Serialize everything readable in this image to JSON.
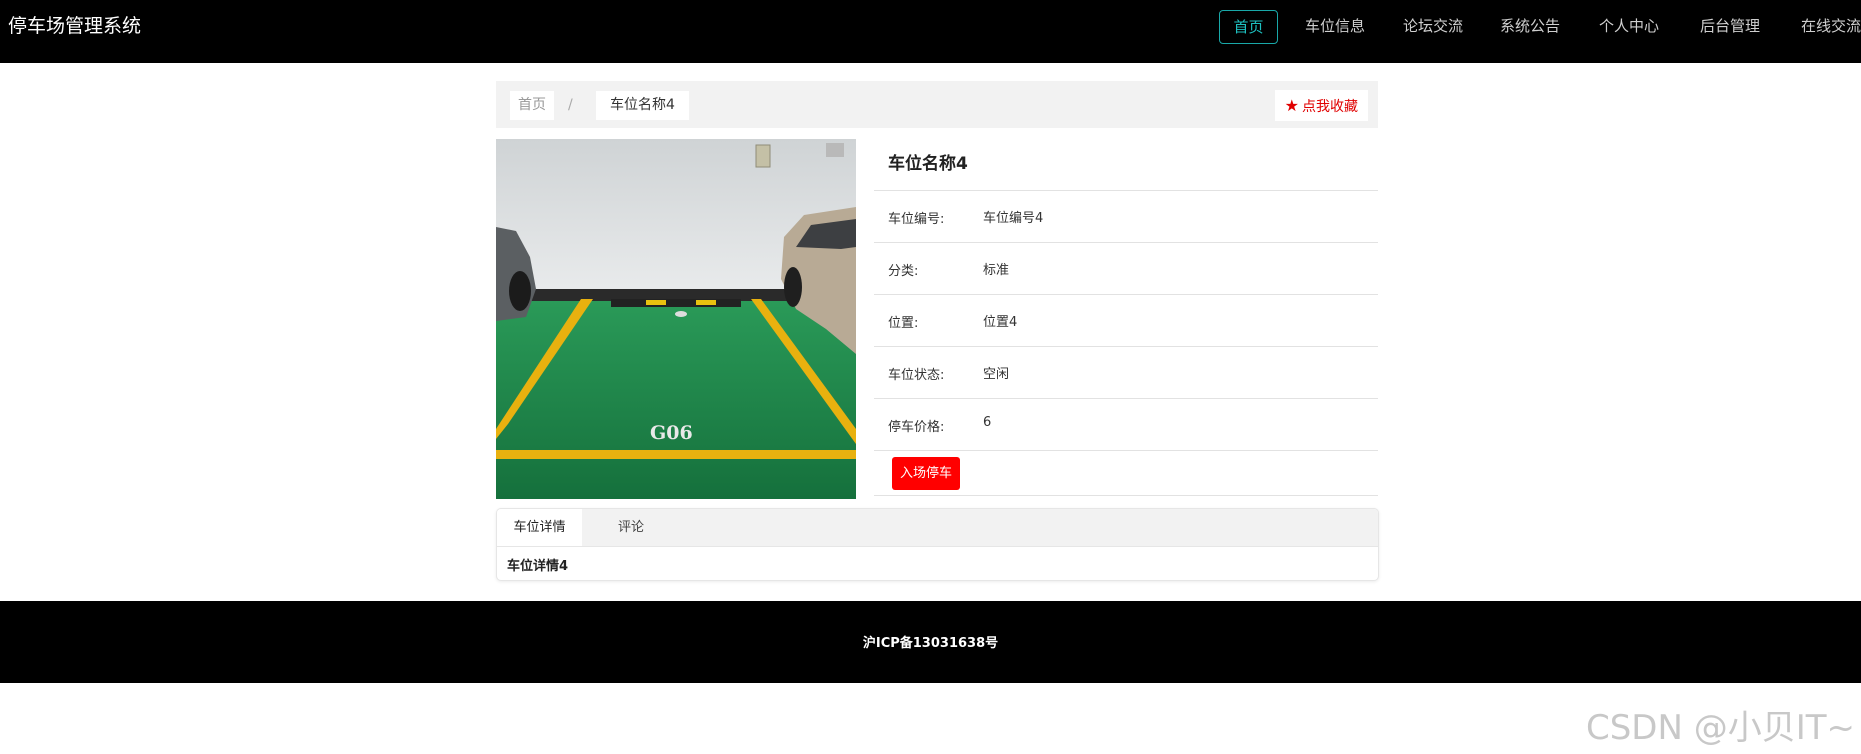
{
  "header": {
    "brand": "停车场管理系统",
    "nav": [
      {
        "label": "首页",
        "active": true
      },
      {
        "label": "车位信息"
      },
      {
        "label": "论坛交流"
      },
      {
        "label": "系统公告"
      },
      {
        "label": "个人中心"
      },
      {
        "label": "后台管理"
      },
      {
        "label": "在线交流"
      }
    ]
  },
  "breadcrumb": {
    "home": "首页",
    "separator": "/",
    "current": "车位名称4",
    "favorite_label": "点我收藏",
    "favorite_icon": "star-icon"
  },
  "photo": {
    "alt": "parking-space-photo",
    "floor_marking": "G06"
  },
  "detail": {
    "title": "车位名称4",
    "fields": [
      {
        "label": "车位编号:",
        "value": "车位编号4"
      },
      {
        "label": "分类:",
        "value": "标准"
      },
      {
        "label": "位置:",
        "value": "位置4"
      },
      {
        "label": "车位状态:",
        "value": "空闲"
      },
      {
        "label": "停车价格:",
        "value": "6"
      }
    ],
    "action_label": "入场停车"
  },
  "tabs": {
    "items": [
      {
        "label": "车位详情",
        "active": true
      },
      {
        "label": "评论"
      }
    ],
    "content": "车位详情4"
  },
  "footer": {
    "text": "沪ICP备13031638号"
  },
  "watermark": "CSDN @小贝IT~",
  "colors": {
    "header_bg": "#000000",
    "nav_active": "#1ec1c1",
    "favorite": "#e00000",
    "action_button": "#ff0000",
    "floor_green": "#1f8a4c",
    "line_yellow": "#e8b10f"
  }
}
